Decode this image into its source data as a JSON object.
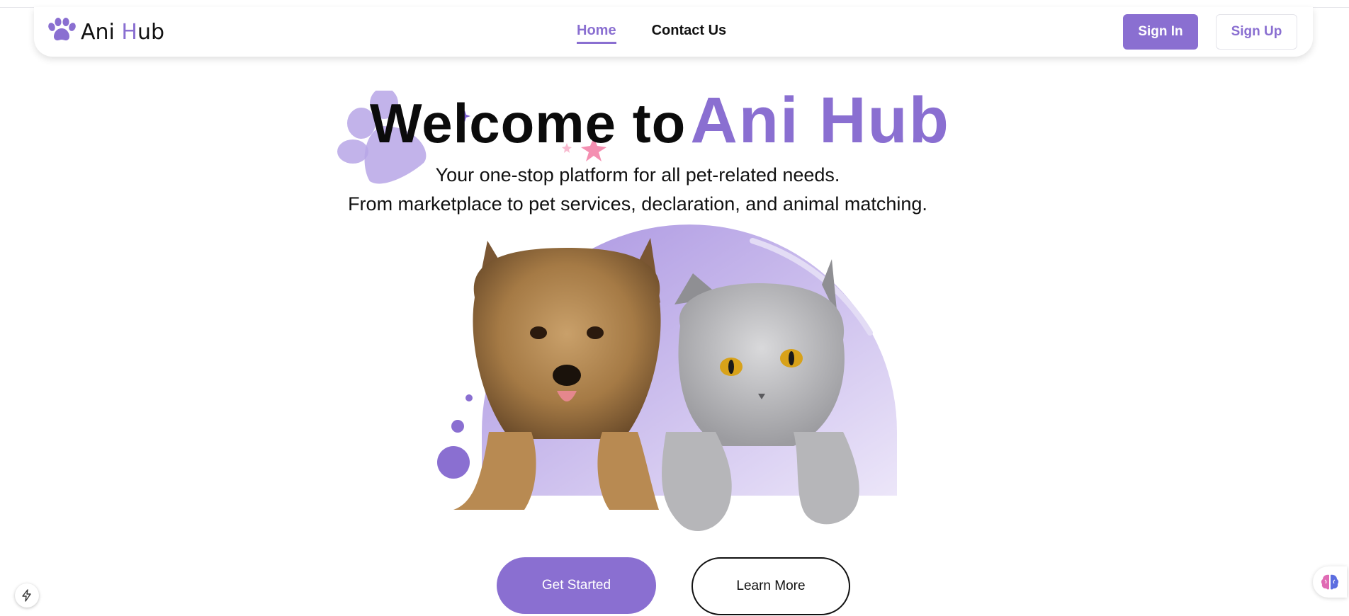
{
  "app": {
    "brand_first": "Ani ",
    "brand_accent": "H",
    "brand_rest": "ub"
  },
  "nav": {
    "links": [
      {
        "label": "Home",
        "active": true
      },
      {
        "label": "Contact Us",
        "active": false
      }
    ],
    "sign_in": "Sign In",
    "sign_up": "Sign Up"
  },
  "hero": {
    "title_prefix": "Welcome to",
    "title_brand": "Ani Hub",
    "subtitle_line1": "Your one-stop platform for all pet-related needs.",
    "subtitle_line2": "From marketplace to pet services, declaration, and animal matching.",
    "primary_cta": "Get Started",
    "secondary_cta": "Learn More"
  },
  "theme": {
    "accent": "#8a6fd1",
    "text": "#111111",
    "background": "#ffffff"
  },
  "icons": {
    "logo": "paw-icon",
    "floating_left": "bolt-icon",
    "floating_right": "brain-icon"
  }
}
